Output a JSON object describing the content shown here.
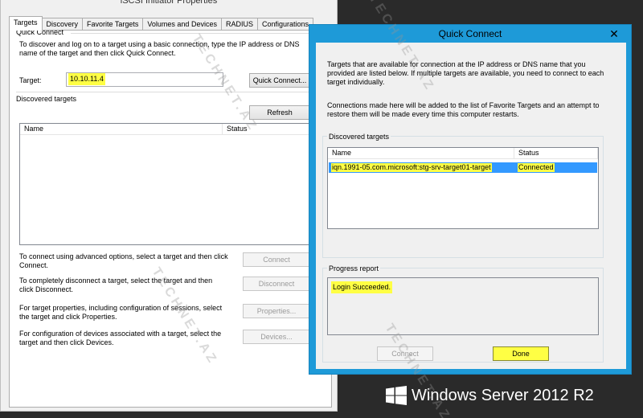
{
  "back_window": {
    "title": "iSCSI Initiator Properties",
    "tabs": [
      "Targets",
      "Discovery",
      "Favorite Targets",
      "Volumes and Devices",
      "RADIUS",
      "Configurations"
    ],
    "quick_connect": {
      "group_label": "Quick Connect",
      "description": "To discover and log on to a target using a basic connection, type the IP address or DNS name of the target and then click Quick Connect.",
      "target_label": "Target:",
      "target_value": "10.10.11.4",
      "button": "Quick Connect..."
    },
    "discovered": {
      "group_label": "Discovered targets",
      "refresh_button": "Refresh",
      "columns": [
        "Name",
        "Status"
      ]
    },
    "actions": [
      {
        "text": "To connect using advanced options, select a target and then click Connect.",
        "button": "Connect"
      },
      {
        "text": "To completely disconnect a target, select the target and then click Disconnect.",
        "button": "Disconnect"
      },
      {
        "text": "For target properties, including configuration of sessions, select the target and click Properties.",
        "button": "Properties..."
      },
      {
        "text": "For configuration of devices associated with a target, select the target and then click Devices.",
        "button": "Devices..."
      }
    ]
  },
  "quick_connect_dialog": {
    "title": "Quick Connect",
    "intro": "Targets that are available for connection at the IP address or DNS name that you provided are listed below.  If multiple targets are available, you need to connect to each target individually.",
    "note": "Connections made here will be added to the list of Favorite Targets and an attempt to restore them will be made every time this computer restarts.",
    "discovered_label": "Discovered targets",
    "columns": [
      "Name",
      "Status"
    ],
    "rows": [
      {
        "name": "iqn.1991-05.com.microsoft:stg-srv-target01-target",
        "status": "Connected"
      }
    ],
    "progress_label": "Progress report",
    "progress_text": "Login Succeeded.",
    "connect_button": "Connect",
    "done_button": "Done"
  },
  "branding": {
    "os_label": "Windows Server 2012 R2",
    "watermark": "TECHNET.AZ"
  },
  "colors": {
    "accent_blue": "#1e9ad8",
    "selection_blue": "#3399ff",
    "highlight_yellow": "#ffff44"
  }
}
